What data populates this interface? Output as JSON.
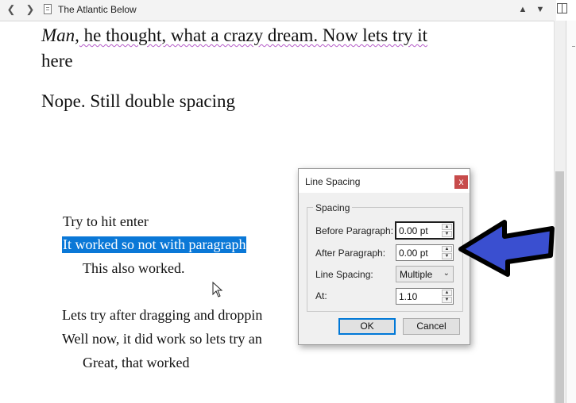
{
  "header": {
    "title": "The Atlantic Below"
  },
  "document": {
    "line1_italic": "Man,",
    "line1_rest": " he thought, what a crazy dream.  Now lets try it",
    "line2": "here",
    "line3": "Nope. Still double spacing",
    "line4": "Try to hit enter",
    "line5_selected": "It worked so not with paragraph",
    "line6": "This also worked.",
    "line7": "Lets try after dragging and droppin",
    "line8": "Well now, it did work so lets try an",
    "line9": "Great, that worked"
  },
  "dialog": {
    "title": "Line Spacing",
    "close_label": "x",
    "group_label": "Spacing",
    "before_paragraph_label": "Before Paragraph:",
    "before_paragraph_value": "0.00 pt",
    "after_paragraph_label": "After Paragraph:",
    "after_paragraph_value": "0.00 pt",
    "line_spacing_label": "Line Spacing:",
    "line_spacing_value": "Multiple",
    "at_label": "At:",
    "at_value": "1.10",
    "ok_label": "OK",
    "cancel_label": "Cancel"
  },
  "colors": {
    "selection": "#0a78d7",
    "arrow_fill": "#3a4fd0",
    "close_button": "#c74b4b"
  }
}
